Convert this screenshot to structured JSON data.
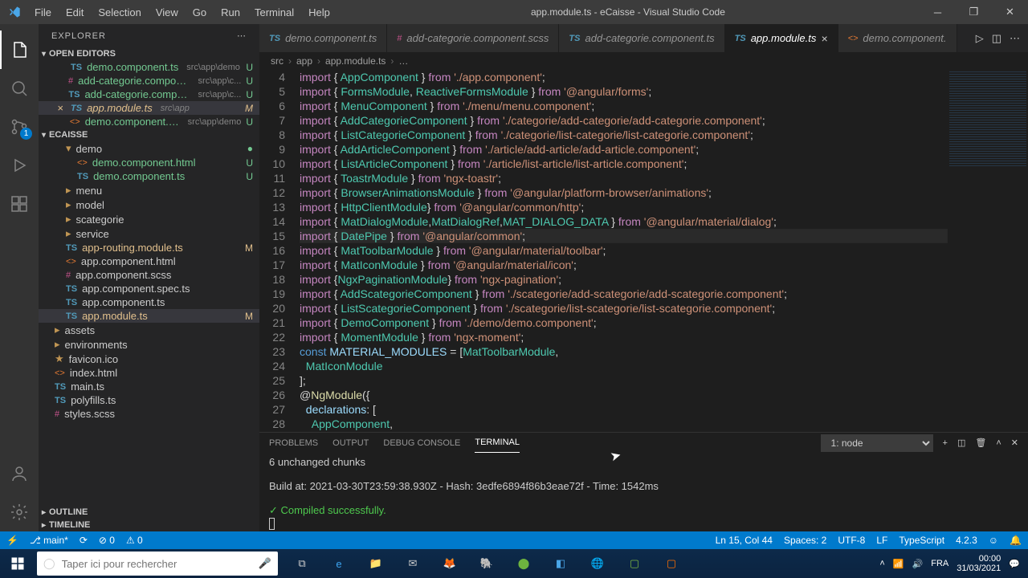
{
  "titlebar": {
    "title": "app.module.ts - eCaisse - Visual Studio Code",
    "menu": [
      "File",
      "Edit",
      "Selection",
      "View",
      "Go",
      "Run",
      "Terminal",
      "Help"
    ]
  },
  "sidebar": {
    "title": "EXPLORER",
    "openEditors": "OPEN EDITORS",
    "project": "ECAISSE",
    "outline": "OUTLINE",
    "timeline": "TIMELINE",
    "editors": [
      {
        "icon": "TS",
        "name": "demo.component.ts",
        "path": "src\\app\\demo",
        "status": "U",
        "git": "u"
      },
      {
        "icon": "#",
        "name": "add-categorie.component.scss",
        "path": "src\\app\\c...",
        "status": "U",
        "git": "u"
      },
      {
        "icon": "TS",
        "name": "add-categorie.component.ts",
        "path": "src\\app\\c...",
        "status": "U",
        "git": "u"
      },
      {
        "icon": "TS",
        "name": "app.module.ts",
        "path": "src\\app",
        "status": "M",
        "git": "m",
        "active": true
      },
      {
        "icon": "<>",
        "name": "demo.component.html",
        "path": "src\\app\\demo",
        "status": "U",
        "git": "u"
      }
    ],
    "tree": [
      {
        "type": "folder",
        "name": "demo",
        "indent": 1,
        "open": true,
        "dot": true
      },
      {
        "type": "file",
        "icon": "<>",
        "name": "demo.component.html",
        "indent": 2,
        "status": "U",
        "git": "u"
      },
      {
        "type": "file",
        "icon": "TS",
        "name": "demo.component.ts",
        "indent": 2,
        "status": "U",
        "git": "u"
      },
      {
        "type": "folder",
        "name": "menu",
        "indent": 1
      },
      {
        "type": "folder",
        "name": "model",
        "indent": 1
      },
      {
        "type": "folder",
        "name": "scategorie",
        "indent": 1
      },
      {
        "type": "folder",
        "name": "service",
        "indent": 1
      },
      {
        "type": "file",
        "icon": "TS",
        "name": "app-routing.module.ts",
        "indent": 1,
        "status": "M",
        "git": "m"
      },
      {
        "type": "file",
        "icon": "<>",
        "name": "app.component.html",
        "indent": 1
      },
      {
        "type": "file",
        "icon": "#",
        "name": "app.component.scss",
        "indent": 1
      },
      {
        "type": "file",
        "icon": "TS",
        "name": "app.component.spec.ts",
        "indent": 1
      },
      {
        "type": "file",
        "icon": "TS",
        "name": "app.component.ts",
        "indent": 1
      },
      {
        "type": "file",
        "icon": "TS",
        "name": "app.module.ts",
        "indent": 1,
        "status": "M",
        "git": "m",
        "selected": true
      },
      {
        "type": "folder",
        "name": "assets",
        "indent": 0
      },
      {
        "type": "folder",
        "name": "environments",
        "indent": 0
      },
      {
        "type": "file",
        "icon": "★",
        "name": "favicon.ico",
        "indent": 0
      },
      {
        "type": "file",
        "icon": "<>",
        "name": "index.html",
        "indent": 0
      },
      {
        "type": "file",
        "icon": "TS",
        "name": "main.ts",
        "indent": 0
      },
      {
        "type": "file",
        "icon": "TS",
        "name": "polyfills.ts",
        "indent": 0
      },
      {
        "type": "file",
        "icon": "#",
        "name": "styles.scss",
        "indent": 0
      }
    ]
  },
  "tabs": [
    {
      "icon": "TS",
      "label": "demo.component.ts"
    },
    {
      "icon": "#",
      "label": "add-categorie.component.scss"
    },
    {
      "icon": "TS",
      "label": "add-categorie.component.ts"
    },
    {
      "icon": "TS",
      "label": "app.module.ts",
      "active": true
    },
    {
      "icon": "<>",
      "label": "demo.component."
    }
  ],
  "breadcrumb": [
    "src",
    "app",
    "app.module.ts",
    "…"
  ],
  "code": {
    "startLine": 4,
    "currentLine": 15,
    "lines": [
      [
        [
          "k",
          "import"
        ],
        [
          "p",
          " { "
        ],
        [
          "t",
          "AppComponent"
        ],
        [
          "p",
          " } "
        ],
        [
          "k",
          "from"
        ],
        [
          "p",
          " "
        ],
        [
          "s",
          "'./app.component'"
        ],
        [
          "p",
          ";"
        ]
      ],
      [
        [
          "k",
          "import"
        ],
        [
          "p",
          " { "
        ],
        [
          "t",
          "FormsModule"
        ],
        [
          "p",
          ", "
        ],
        [
          "t",
          "ReactiveFormsModule"
        ],
        [
          "p",
          " } "
        ],
        [
          "k",
          "from"
        ],
        [
          "p",
          " "
        ],
        [
          "s",
          "'@angular/forms'"
        ],
        [
          "p",
          ";"
        ]
      ],
      [
        [
          "k",
          "import"
        ],
        [
          "p",
          " { "
        ],
        [
          "t",
          "MenuComponent"
        ],
        [
          "p",
          " } "
        ],
        [
          "k",
          "from"
        ],
        [
          "p",
          " "
        ],
        [
          "s",
          "'./menu/menu.component'"
        ],
        [
          "p",
          ";"
        ]
      ],
      [
        [
          "k",
          "import"
        ],
        [
          "p",
          " { "
        ],
        [
          "t",
          "AddCategorieComponent"
        ],
        [
          "p",
          " } "
        ],
        [
          "k",
          "from"
        ],
        [
          "p",
          " "
        ],
        [
          "s",
          "'./categorie/add-categorie/add-categorie.component'"
        ],
        [
          "p",
          ";"
        ]
      ],
      [
        [
          "k",
          "import"
        ],
        [
          "p",
          " { "
        ],
        [
          "t",
          "ListCategorieComponent"
        ],
        [
          "p",
          " } "
        ],
        [
          "k",
          "from"
        ],
        [
          "p",
          " "
        ],
        [
          "s",
          "'./categorie/list-categorie/list-categorie.component'"
        ],
        [
          "p",
          ";"
        ]
      ],
      [
        [
          "k",
          "import"
        ],
        [
          "p",
          " { "
        ],
        [
          "t",
          "AddArticleComponent"
        ],
        [
          "p",
          " } "
        ],
        [
          "k",
          "from"
        ],
        [
          "p",
          " "
        ],
        [
          "s",
          "'./article/add-article/add-article.component'"
        ],
        [
          "p",
          ";"
        ]
      ],
      [
        [
          "k",
          "import"
        ],
        [
          "p",
          " { "
        ],
        [
          "t",
          "ListArticleComponent"
        ],
        [
          "p",
          " } "
        ],
        [
          "k",
          "from"
        ],
        [
          "p",
          " "
        ],
        [
          "s",
          "'./article/list-article/list-article.component'"
        ],
        [
          "p",
          ";"
        ]
      ],
      [
        [
          "k",
          "import"
        ],
        [
          "p",
          " { "
        ],
        [
          "t",
          "ToastrModule"
        ],
        [
          "p",
          " } "
        ],
        [
          "k",
          "from"
        ],
        [
          "p",
          " "
        ],
        [
          "s",
          "'ngx-toastr'"
        ],
        [
          "p",
          ";"
        ]
      ],
      [
        [
          "k",
          "import"
        ],
        [
          "p",
          " { "
        ],
        [
          "t",
          "BrowserAnimationsModule"
        ],
        [
          "p",
          " } "
        ],
        [
          "k",
          "from"
        ],
        [
          "p",
          " "
        ],
        [
          "s",
          "'@angular/platform-browser/animations'"
        ],
        [
          "p",
          ";"
        ]
      ],
      [
        [
          "k",
          "import"
        ],
        [
          "p",
          " { "
        ],
        [
          "t",
          "HttpClientModule"
        ],
        [
          "p",
          "} "
        ],
        [
          "k",
          "from"
        ],
        [
          "p",
          " "
        ],
        [
          "s",
          "'@angular/common/http'"
        ],
        [
          "p",
          ";"
        ]
      ],
      [
        [
          "k",
          "import"
        ],
        [
          "p",
          " { "
        ],
        [
          "t",
          "MatDialogModule"
        ],
        [
          "p",
          ","
        ],
        [
          "t",
          "MatDialogRef"
        ],
        [
          "p",
          ","
        ],
        [
          "t",
          "MAT_DIALOG_DATA"
        ],
        [
          "p",
          " } "
        ],
        [
          "k",
          "from"
        ],
        [
          "p",
          " "
        ],
        [
          "s",
          "'@angular/material/dialog'"
        ],
        [
          "p",
          ";"
        ]
      ],
      [
        [
          "k",
          "import"
        ],
        [
          "p",
          " { "
        ],
        [
          "t",
          "DatePipe"
        ],
        [
          "p",
          " } "
        ],
        [
          "k",
          "from"
        ],
        [
          "p",
          " "
        ],
        [
          "s",
          "'@angular/common'"
        ],
        [
          "p",
          ";"
        ]
      ],
      [
        [
          "k",
          "import"
        ],
        [
          "p",
          " { "
        ],
        [
          "t",
          "MatToolbarModule"
        ],
        [
          "p",
          " } "
        ],
        [
          "k",
          "from"
        ],
        [
          "p",
          " "
        ],
        [
          "s",
          "'@angular/material/toolbar'"
        ],
        [
          "p",
          ";"
        ]
      ],
      [
        [
          "k",
          "import"
        ],
        [
          "p",
          " { "
        ],
        [
          "t",
          "MatIconModule"
        ],
        [
          "p",
          " } "
        ],
        [
          "k",
          "from"
        ],
        [
          "p",
          " "
        ],
        [
          "s",
          "'@angular/material/icon'"
        ],
        [
          "p",
          ";"
        ]
      ],
      [
        [
          "k",
          "import"
        ],
        [
          "p",
          " {"
        ],
        [
          "t",
          "NgxPaginationModule"
        ],
        [
          "p",
          "} "
        ],
        [
          "k",
          "from"
        ],
        [
          "p",
          " "
        ],
        [
          "s",
          "'ngx-pagination'"
        ],
        [
          "p",
          ";"
        ]
      ],
      [
        [
          "k",
          "import"
        ],
        [
          "p",
          " { "
        ],
        [
          "t",
          "AddScategorieComponent"
        ],
        [
          "p",
          " } "
        ],
        [
          "k",
          "from"
        ],
        [
          "p",
          " "
        ],
        [
          "s",
          "'./scategorie/add-scategorie/add-scategorie.component'"
        ],
        [
          "p",
          ";"
        ]
      ],
      [
        [
          "k",
          "import"
        ],
        [
          "p",
          " { "
        ],
        [
          "t",
          "ListScategorieComponent"
        ],
        [
          "p",
          " } "
        ],
        [
          "k",
          "from"
        ],
        [
          "p",
          " "
        ],
        [
          "s",
          "'./scategorie/list-scategorie/list-scategorie.component'"
        ],
        [
          "p",
          ";"
        ]
      ],
      [
        [
          "k",
          "import"
        ],
        [
          "p",
          " { "
        ],
        [
          "t",
          "DemoComponent"
        ],
        [
          "p",
          " } "
        ],
        [
          "k",
          "from"
        ],
        [
          "p",
          " "
        ],
        [
          "s",
          "'./demo/demo.component'"
        ],
        [
          "p",
          ";"
        ]
      ],
      [
        [
          "k",
          "import"
        ],
        [
          "p",
          " { "
        ],
        [
          "t",
          "MomentModule"
        ],
        [
          "p",
          " } "
        ],
        [
          "k",
          "from"
        ],
        [
          "p",
          " "
        ],
        [
          "s",
          "'ngx-moment'"
        ],
        [
          "p",
          ";"
        ]
      ],
      [
        [
          "b",
          "const"
        ],
        [
          "p",
          " "
        ],
        [
          "v",
          "MATERIAL_MODULES"
        ],
        [
          "p",
          " = ["
        ],
        [
          "t",
          "MatToolbarModule"
        ],
        [
          "p",
          ","
        ]
      ],
      [
        [
          "p",
          "  "
        ],
        [
          "t",
          "MatIconModule"
        ]
      ],
      [
        [
          "p",
          "];"
        ]
      ],
      [
        [
          "p",
          "@"
        ],
        [
          "y",
          "NgModule"
        ],
        [
          "p",
          "({"
        ]
      ],
      [
        [
          "p",
          "  "
        ],
        [
          "v",
          "declarations"
        ],
        [
          "p",
          ": ["
        ]
      ],
      [
        [
          "p",
          "    "
        ],
        [
          "t",
          "AppComponent"
        ],
        [
          "p",
          ","
        ]
      ]
    ]
  },
  "panel": {
    "tabs": [
      "PROBLEMS",
      "OUTPUT",
      "DEBUG CONSOLE",
      "TERMINAL"
    ],
    "active": 3,
    "select": "1: node",
    "lines": [
      "6 unchanged chunks",
      "",
      "Build at: 2021-03-30T23:59:38.930Z - Hash: 3edfe6894f86b3eae72f - Time: 1542ms",
      ""
    ],
    "success": "✓ Compiled successfully."
  },
  "statusbar": {
    "branch": "main*",
    "sync": "⟳",
    "errors": "⊘ 0",
    "warnings": "⚠ 0",
    "cursor": "Ln 15, Col 44",
    "spaces": "Spaces: 2",
    "encoding": "UTF-8",
    "eol": "LF",
    "lang": "TypeScript",
    "ver": "4.2.3"
  },
  "scm_badge": "1",
  "taskbar": {
    "placeholder": "Taper ici pour rechercher",
    "time": "00:00",
    "date": "31/03/2021"
  }
}
